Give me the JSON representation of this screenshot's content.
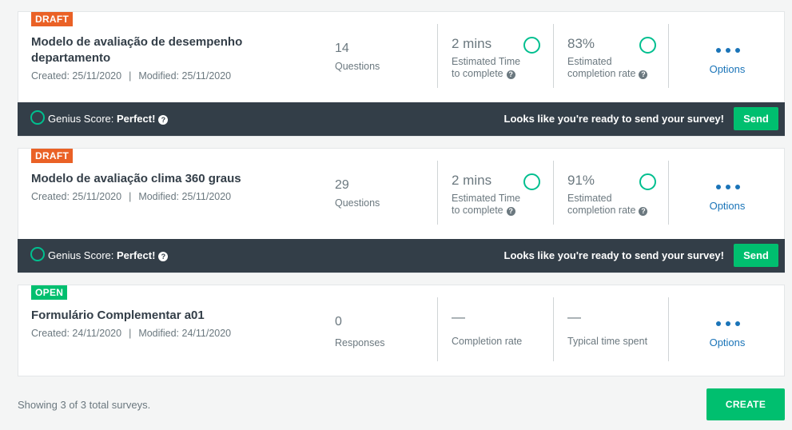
{
  "surveys": [
    {
      "status": "DRAFT",
      "title": "Modelo de avaliação de desempenho departamento",
      "created_label": "Created: 25/11/2020",
      "separator": "|",
      "modified_label": "Modified: 25/11/2020",
      "stat1_value": "14",
      "stat1_label": "Questions",
      "stat2_value": "2 mins",
      "stat2_label_line1": "Estimated Time",
      "stat2_label_line2": "to complete",
      "stat3_value": "83%",
      "stat3_label_line1": "Estimated",
      "stat3_label_line2": "completion rate",
      "options_label": "Options",
      "genius_label": "Genius Score:",
      "genius_value": "Perfect!",
      "ready_text": "Looks like you're ready to send your survey!",
      "send_label": "Send"
    },
    {
      "status": "DRAFT",
      "title": "Modelo de avaliação clima 360 graus",
      "created_label": "Created: 25/11/2020",
      "separator": "|",
      "modified_label": "Modified: 25/11/2020",
      "stat1_value": "29",
      "stat1_label": "Questions",
      "stat2_value": "2 mins",
      "stat2_label_line1": "Estimated Time",
      "stat2_label_line2": "to complete",
      "stat3_value": "91%",
      "stat3_label_line1": "Estimated",
      "stat3_label_line2": "completion rate",
      "options_label": "Options",
      "genius_label": "Genius Score:",
      "genius_value": "Perfect!",
      "ready_text": "Looks like you're ready to send your survey!",
      "send_label": "Send"
    },
    {
      "status": "OPEN",
      "title": "Formulário Complementar a01",
      "created_label": "Created: 24/11/2020",
      "separator": "|",
      "modified_label": "Modified: 24/11/2020",
      "stat1_value": "0",
      "stat1_label": "Responses",
      "stat2_value": "—",
      "stat2_label_line1": "Completion rate",
      "stat3_value": "—",
      "stat3_label_line1": "Typical time spent",
      "options_label": "Options"
    }
  ],
  "help_glyph": "?",
  "footer": {
    "summary": "Showing 3 of 3 total surveys.",
    "create_label": "CREATE"
  },
  "colors": {
    "draft_badge": "#ea6126",
    "open_badge": "#00bf6f",
    "genius_bar": "#333e48",
    "accent_green": "#00bf6f",
    "link_blue": "#1a74b8"
  },
  "icons": {
    "genius_ring": "circle-outline-icon",
    "help": "question-circle-icon",
    "options": "ellipsis-icon"
  }
}
